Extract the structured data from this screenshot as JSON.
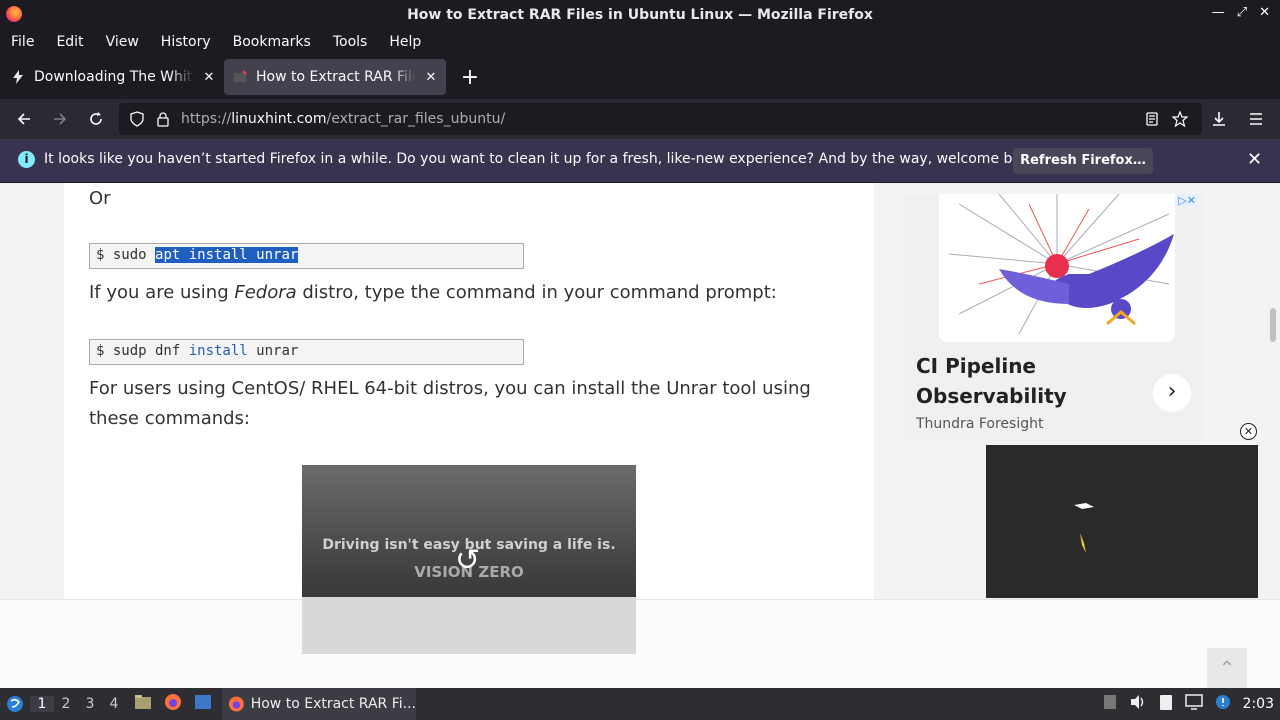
{
  "window": {
    "title": "How to Extract RAR Files in Ubuntu Linux — Mozilla Firefox"
  },
  "menu": [
    "File",
    "Edit",
    "View",
    "History",
    "Bookmarks",
    "Tools",
    "Help"
  ],
  "tabs": [
    {
      "label": "Downloading The White House",
      "active": false
    },
    {
      "label": "How to Extract RAR Files in Ubuntu Linux",
      "active": true
    }
  ],
  "url": {
    "prefix": "https://",
    "domain": "linuxhint.com",
    "path": "/extract_rar_files_ubuntu/"
  },
  "notification": {
    "message": "It looks like you haven’t started Firefox in a while. Do you want to clean it up for a fresh, like-new experience? And by the way, welcome back!",
    "button": "Refresh Firefox…"
  },
  "article": {
    "or": "Or",
    "code1": {
      "prompt": "$ sudo ",
      "selected": "apt install unrar"
    },
    "fedora_pre": "If you are using ",
    "fedora_em": "Fedora",
    "fedora_post": " distro, type the command in your command prompt:",
    "code2": {
      "prompt": "$ sudp dnf ",
      "kw": "install",
      "rest": " unrar"
    },
    "centos_line1": "For users using CentOS/ RHEL 64-bit distros, you can install the Unrar tool using",
    "centos_line2": "these commands:"
  },
  "video": {
    "line1": "Driving isn't easy but saving a life is.",
    "line2": "VISION ZERO"
  },
  "side_ad": {
    "headline": "CI Pipeline Observability",
    "sponsor": "Thundra Foresight"
  },
  "taskbar": {
    "workspaces": [
      "1",
      "2",
      "3",
      "4"
    ],
    "active_workspace": "1",
    "task_label": "How to Extract RAR Fi...",
    "clock": "2:03"
  }
}
